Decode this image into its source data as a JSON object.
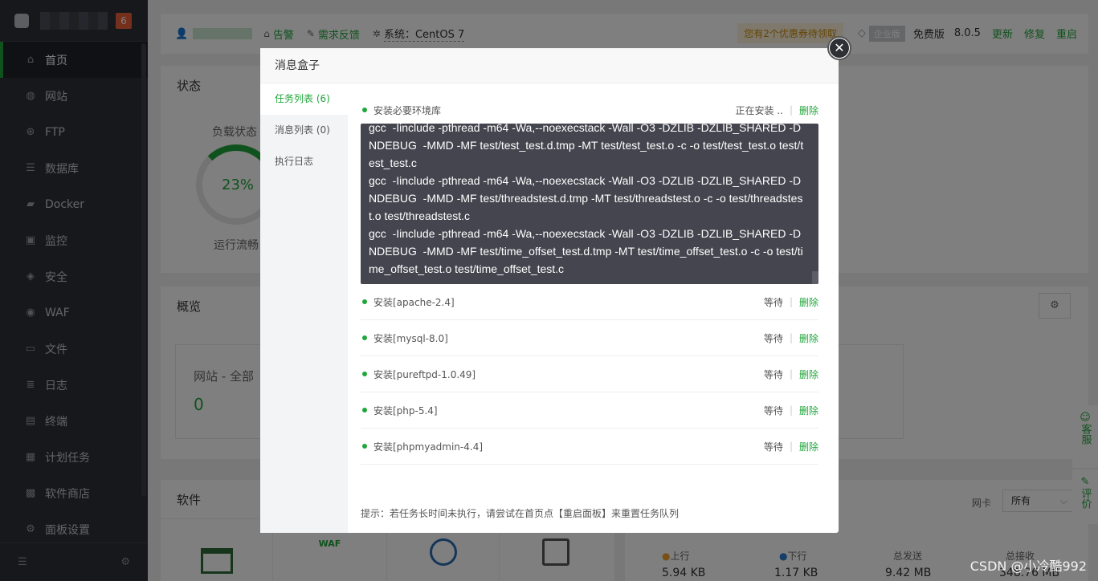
{
  "sidebar": {
    "badge": "6",
    "items": [
      {
        "label": "首页",
        "icon": "home-icon"
      },
      {
        "label": "网站",
        "icon": "globe-icon"
      },
      {
        "label": "FTP",
        "icon": "ftp-icon"
      },
      {
        "label": "数据库",
        "icon": "database-icon"
      },
      {
        "label": "Docker",
        "icon": "docker-icon"
      },
      {
        "label": "监控",
        "icon": "monitor-icon"
      },
      {
        "label": "安全",
        "icon": "shield-icon"
      },
      {
        "label": "WAF",
        "icon": "waf-icon"
      },
      {
        "label": "文件",
        "icon": "folder-icon"
      },
      {
        "label": "日志",
        "icon": "log-icon"
      },
      {
        "label": "终端",
        "icon": "terminal-icon"
      },
      {
        "label": "计划任务",
        "icon": "calendar-icon"
      },
      {
        "label": "软件商店",
        "icon": "store-icon"
      },
      {
        "label": "面板设置",
        "icon": "settings-icon"
      }
    ]
  },
  "topbar": {
    "alarm": "告警",
    "feedback": "需求反馈",
    "system": "系统：CentOS 7",
    "coupon": "您有2个优惠券待领取",
    "enterprise": "企业版",
    "free": "免费版",
    "version": "8.0.5",
    "update": "更新",
    "repair": "修复",
    "restart": "重启"
  },
  "background": {
    "status_title": "状态",
    "load_label": "负载状态",
    "load_value": "23%",
    "load_desc": "运行流畅",
    "overview_title": "概览",
    "site_label": "网站 - 全部",
    "site_value": "0",
    "software_title": "软件",
    "nic_label": "网卡",
    "nic_value": "所有",
    "up_label": "上行",
    "up_value": "5.94 KB",
    "down_label": "下行",
    "down_value": "1.17 KB",
    "total_send_label": "总发送",
    "total_send_value": "9.42 MB",
    "total_recv_label": "总接收",
    "total_recv_value": "348.76 MB"
  },
  "float": {
    "service": "客服",
    "rate": "评价"
  },
  "modal": {
    "title": "消息盒子",
    "tabs": [
      "任务列表 (6)",
      "消息列表 (0)",
      "执行日志"
    ],
    "first_task": {
      "name": "安装必要环境库",
      "status": "正在安装 ..",
      "delete": "删除"
    },
    "log_lines": [
      "gcc  -Iinclude -pthread -m64 -Wa,--noexecstack -Wall -O3 -DZLIB -DZLIB_SHARED -DNDEBUG  -MMD -MF test/test_test.d.tmp -MT test/test_test.o -c -o test/test_test.o test/test_test.c",
      "gcc  -Iinclude -pthread -m64 -Wa,--noexecstack -Wall -O3 -DZLIB -DZLIB_SHARED -DNDEBUG  -MMD -MF test/threadstest.d.tmp -MT test/threadstest.o -c -o test/threadstest.o test/threadstest.c",
      "gcc  -Iinclude -pthread -m64 -Wa,--noexecstack -Wall -O3 -DZLIB -DZLIB_SHARED -DNDEBUG  -MMD -MF test/time_offset_test.d.tmp -MT test/time_offset_test.o -c -o test/time_offset_test.o test/time_offset_test.c"
    ],
    "tasks": [
      {
        "name": "安装[apache-2.4]",
        "status": "等待",
        "delete": "删除"
      },
      {
        "name": "安装[mysql-8.0]",
        "status": "等待",
        "delete": "删除"
      },
      {
        "name": "安装[pureftpd-1.0.49]",
        "status": "等待",
        "delete": "删除"
      },
      {
        "name": "安装[php-5.4]",
        "status": "等待",
        "delete": "删除"
      },
      {
        "name": "安装[phpmyadmin-4.4]",
        "status": "等待",
        "delete": "删除"
      }
    ],
    "tip": "提示：若任务长时间未执行，请尝试在首页点【重启面板】来重置任务队列"
  },
  "watermark": "CSDN @小冷酷992",
  "colors": {
    "accent": "#20a53a",
    "sidebar": "#2c3038",
    "log_bg": "#45454f"
  }
}
